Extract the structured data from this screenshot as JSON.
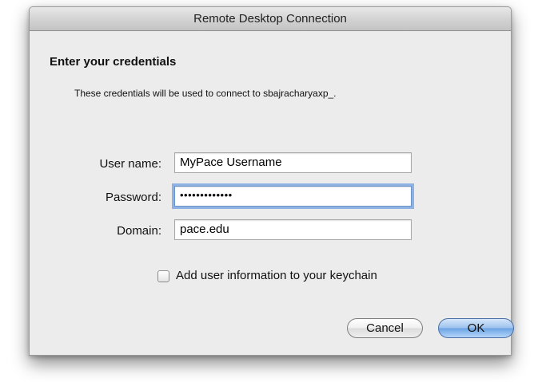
{
  "window": {
    "title": "Remote Desktop Connection"
  },
  "dialog": {
    "heading": "Enter your credentials",
    "description": "These credentials will be used to connect to sbajracharyaxp_."
  },
  "form": {
    "username": {
      "label": "User name:",
      "value": "MyPace Username"
    },
    "password": {
      "label": "Password:",
      "value": "•••••••••••••"
    },
    "domain": {
      "label": "Domain:",
      "value": "pace.edu"
    }
  },
  "keychain": {
    "label": "Add user information to your keychain",
    "checked": false
  },
  "buttons": {
    "cancel": "Cancel",
    "ok": "OK"
  },
  "colors": {
    "window_bg": "#ececec",
    "focus_ring": "#8db2e3",
    "default_button": "#6aa2e4"
  }
}
